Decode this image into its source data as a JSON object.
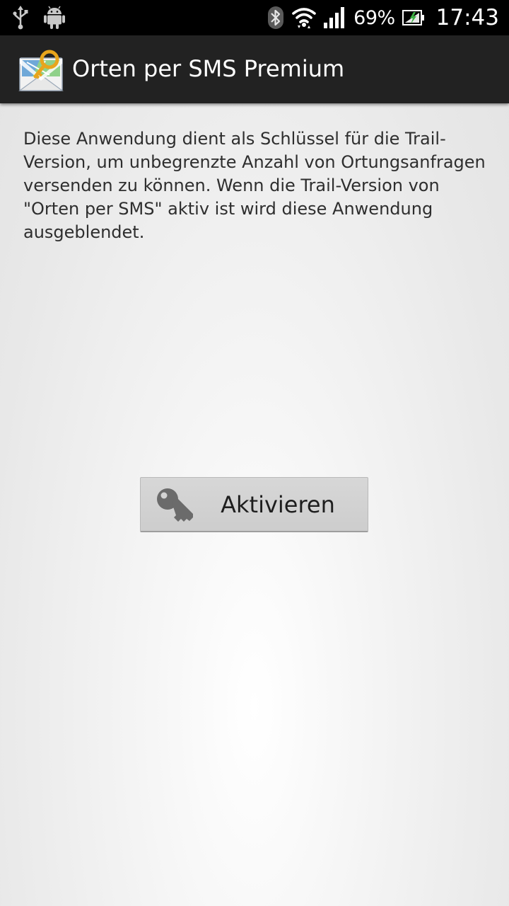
{
  "status_bar": {
    "icons_left": [
      "usb-icon",
      "android-icon"
    ],
    "icons_right": [
      "bluetooth-icon",
      "wifi-icon",
      "signal-icon",
      "battery-charging-icon"
    ],
    "battery_percent": "69%",
    "time": "17:43"
  },
  "action_bar": {
    "app_icon": "envelope-key-map-icon",
    "title": "Orten per SMS Premium"
  },
  "content": {
    "description": "Diese Anwendung dient als Schlüssel für die Trail-Version, um unbegrenzte Anzahl von Ortungsanfragen versenden zu können. Wenn die Trail-Version von \"Orten per SMS\" aktiv ist wird diese Anwendung ausgeblendet."
  },
  "activate_button": {
    "icon": "key-icon",
    "label": "Aktivieren"
  },
  "colors": {
    "status_bar": "#000000",
    "action_bar": "#222222",
    "button_face": "#d2d2d2",
    "key_icon": "#6b6b6b"
  }
}
